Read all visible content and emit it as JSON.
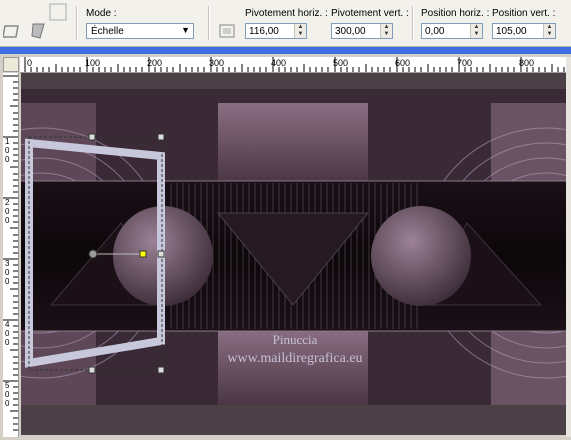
{
  "toolbar": {
    "mode_label": "Mode :",
    "mode_value": "Échelle",
    "pivot_h_label": "Pivotement horiz. :",
    "pivot_h_value": "116,00",
    "pivot_v_label": "Pivotement vert. :",
    "pivot_v_value": "300,00",
    "pos_h_label": "Position horiz. :",
    "pos_h_value": "0,00",
    "pos_v_label": "Position vert. :",
    "pos_v_value": "105,00"
  },
  "ruler_top": {
    "labels": [
      "0",
      "100",
      "200",
      "300",
      "400",
      "500",
      "600",
      "700",
      "800"
    ]
  },
  "ruler_left": {
    "labels": [
      "1",
      "0",
      "0",
      "2",
      "0",
      "0",
      "3",
      "0",
      "0",
      "4",
      "0",
      "0",
      "5",
      "0",
      "0"
    ]
  },
  "watermark": {
    "line1": "Pinuccia",
    "line2": "www.maildiregrafica.eu"
  },
  "colors": {
    "accent": "#3e6ee0",
    "image_dark": "#2a1c26",
    "image_mauve": "#7a5e72",
    "frame_light": "#c8c8dc"
  },
  "icons": [
    "pick-tool-icon",
    "deform-icon",
    "close-icon",
    "reset-icon"
  ]
}
